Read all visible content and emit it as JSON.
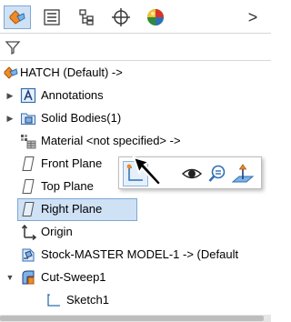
{
  "tabs": [
    {
      "name": "feature-manager"
    },
    {
      "name": "property-manager"
    },
    {
      "name": "configuration-manager"
    },
    {
      "name": "dimxpert-manager"
    },
    {
      "name": "display-manager"
    }
  ],
  "tab_overflow": ">",
  "tree": {
    "root_label": "HATCH  (Default) ->",
    "items": [
      {
        "label": "Annotations"
      },
      {
        "label": "Solid Bodies(1)"
      },
      {
        "label": "Material <not specified> ->"
      },
      {
        "label": "Front Plane"
      },
      {
        "label": "Top Plane"
      },
      {
        "label": "Right Plane"
      },
      {
        "label": "Origin"
      },
      {
        "label": "Stock-MASTER MODEL-1 -> (Default"
      },
      {
        "label": "Cut-Sweep1"
      },
      {
        "label": "Sketch1"
      }
    ]
  },
  "colors": {
    "selection_fill": "#cfe1f5",
    "selection_border": "#7fa7d3",
    "accent_orange": "#f08a24",
    "accent_blue": "#2f6fb3"
  }
}
